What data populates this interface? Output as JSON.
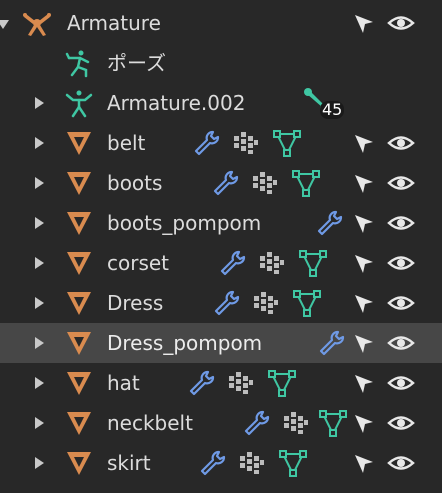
{
  "outliner": {
    "root": {
      "label": "Armature",
      "icon": "armature-icon"
    },
    "pose": {
      "label": "ポーズ",
      "icon": "pose-icon"
    },
    "child_armature": {
      "label": "Armature.002",
      "icon": "armature-object-icon",
      "bone_count": "45"
    },
    "objects": [
      {
        "label": "belt"
      },
      {
        "label": "boots"
      },
      {
        "label": "boots_pompom"
      },
      {
        "label": "corset"
      },
      {
        "label": "Dress"
      },
      {
        "label": "Dress_pompom"
      },
      {
        "label": "hat"
      },
      {
        "label": "neckbelt"
      },
      {
        "label": "skirt"
      }
    ],
    "selected_row": "Dress_pompom"
  },
  "colors": {
    "background": "#282828",
    "selected_row": "#474747",
    "mesh_orange": "#d98b4f",
    "modifier_blue": "#6f9ae6",
    "data_green": "#3fc7a3",
    "icon_white": "#e8e8e8"
  }
}
